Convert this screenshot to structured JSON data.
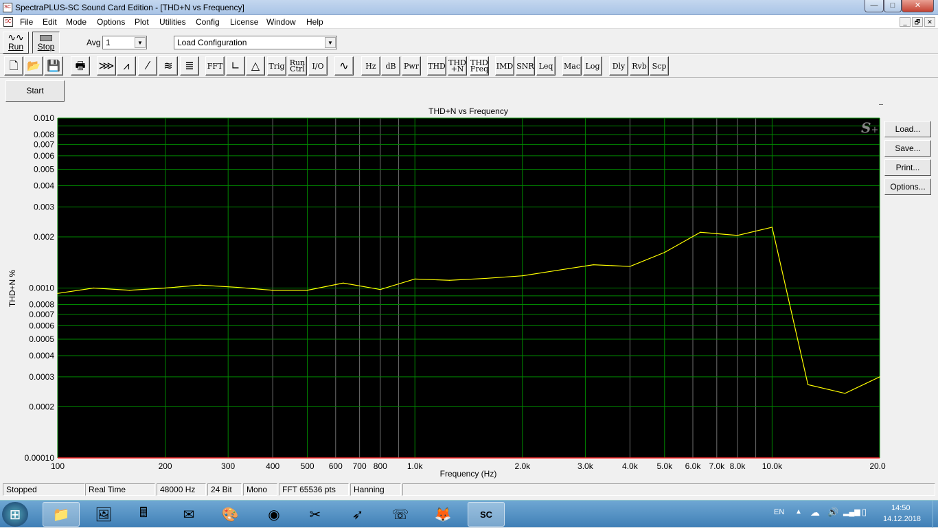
{
  "window": {
    "title": "SpectraPLUS-SC Sound Card Edition - [THD+N vs Frequency]",
    "minimize": "—",
    "maximize": "□",
    "close": "✕"
  },
  "menu": [
    "File",
    "Edit",
    "Mode",
    "Options",
    "Plot",
    "Utilities",
    "Config",
    "License",
    "Window",
    "Help"
  ],
  "mdi_controls": [
    "_",
    "🗗",
    "✕"
  ],
  "toolbar": {
    "run": "Run",
    "stop": "Stop",
    "avg_label": "Avg",
    "avg_value": "1",
    "config_value": "Load Configuration"
  },
  "toolbar2": [
    {
      "id": "new",
      "icon": "new-file-icon",
      "glyph": "🗋"
    },
    {
      "id": "open",
      "icon": "open-folder-icon",
      "glyph": "📂"
    },
    {
      "id": "save",
      "icon": "save-disk-icon",
      "glyph": "💾"
    },
    {
      "id": "print",
      "icon": "printer-icon",
      "glyph": "🖶"
    },
    {
      "id": "time-series",
      "icon": "waveform-icon",
      "glyph": "⋙"
    },
    {
      "id": "spectrum",
      "icon": "spectrum-icon",
      "glyph": "⩘"
    },
    {
      "id": "phase",
      "icon": "phase-icon",
      "glyph": "⁄"
    },
    {
      "id": "spectrogram",
      "icon": "spectrogram-icon",
      "glyph": "≋"
    },
    {
      "id": "3d",
      "icon": "3d-surface-icon",
      "glyph": "≣"
    },
    {
      "label": "FFT"
    },
    {
      "id": "scaling",
      "icon": "axis-scale-icon",
      "glyph": "∟"
    },
    {
      "id": "weighting",
      "icon": "weighting-icon",
      "glyph": "△"
    },
    {
      "label": "Trig"
    },
    {
      "label": "Run Ctrl"
    },
    {
      "label": "I/O"
    },
    {
      "id": "generator",
      "icon": "sine-generator-icon",
      "glyph": "∿"
    },
    {
      "label": "Hz"
    },
    {
      "label": "dB"
    },
    {
      "label": "Pwr"
    },
    {
      "label": "THD"
    },
    {
      "label": "THD +N"
    },
    {
      "label": "THD Freq"
    },
    {
      "label": "IMD"
    },
    {
      "label": "SNR"
    },
    {
      "label": "Leq"
    },
    {
      "label": "Mac"
    },
    {
      "label": "Log"
    },
    {
      "label": "Dly"
    },
    {
      "label": "Rvb"
    },
    {
      "label": "Scp"
    }
  ],
  "start_button": "Start",
  "side_buttons": [
    "Load...",
    "Save...",
    "Print...",
    "Options..."
  ],
  "logo": "S+",
  "chart_data": {
    "type": "line",
    "title": "THD+N vs Frequency",
    "xlabel": "Frequency (Hz)",
    "ylabel": "THD+N  %",
    "xscale": "log",
    "yscale": "log",
    "xlim": [
      100,
      20000
    ],
    "ylim": [
      0.0001,
      0.01
    ],
    "grid": true,
    "xticks": [
      {
        "v": 100,
        "l": "100"
      },
      {
        "v": 200,
        "l": "200"
      },
      {
        "v": 300,
        "l": "300"
      },
      {
        "v": 400,
        "l": "400"
      },
      {
        "v": 500,
        "l": "500"
      },
      {
        "v": 600,
        "l": "600"
      },
      {
        "v": 700,
        "l": "700"
      },
      {
        "v": 800,
        "l": "800"
      },
      {
        "v": 1000,
        "l": "1.0k"
      },
      {
        "v": 2000,
        "l": "2.0k"
      },
      {
        "v": 3000,
        "l": "3.0k"
      },
      {
        "v": 4000,
        "l": "4.0k"
      },
      {
        "v": 5000,
        "l": "5.0k"
      },
      {
        "v": 6000,
        "l": "6.0k"
      },
      {
        "v": 7000,
        "l": "7.0k"
      },
      {
        "v": 8000,
        "l": "8.0k"
      },
      {
        "v": 10000,
        "l": "10.0k"
      },
      {
        "v": 20000,
        "l": "20.0k"
      }
    ],
    "yticks": [
      {
        "v": 0.01,
        "l": "0.010"
      },
      {
        "v": 0.008,
        "l": "0.008"
      },
      {
        "v": 0.007,
        "l": "0.007"
      },
      {
        "v": 0.006,
        "l": "0.006"
      },
      {
        "v": 0.005,
        "l": "0.005"
      },
      {
        "v": 0.004,
        "l": "0.004"
      },
      {
        "v": 0.003,
        "l": "0.003"
      },
      {
        "v": 0.002,
        "l": "0.002"
      },
      {
        "v": 0.001,
        "l": "0.0010"
      },
      {
        "v": 0.0008,
        "l": "0.0008"
      },
      {
        "v": 0.0007,
        "l": "0.0007"
      },
      {
        "v": 0.0006,
        "l": "0.0006"
      },
      {
        "v": 0.0005,
        "l": "0.0005"
      },
      {
        "v": 0.0004,
        "l": "0.0004"
      },
      {
        "v": 0.0003,
        "l": "0.0003"
      },
      {
        "v": 0.0002,
        "l": "0.0002"
      },
      {
        "v": 0.0001,
        "l": "0.00010"
      }
    ],
    "series": [
      {
        "name": "THD+N",
        "color": "#ffff00",
        "x": [
          100,
          126,
          159,
          200,
          250,
          317,
          400,
          500,
          630,
          800,
          1000,
          1250,
          1580,
          2000,
          2500,
          3160,
          4000,
          5000,
          6300,
          8000,
          10000,
          12600,
          16000,
          20000
        ],
        "y": [
          0.00093,
          0.001,
          0.00097,
          0.001,
          0.00104,
          0.00101,
          0.00097,
          0.00097,
          0.00107,
          0.00098,
          0.00113,
          0.00111,
          0.00114,
          0.00118,
          0.00127,
          0.00137,
          0.00134,
          0.00162,
          0.00213,
          0.00204,
          0.00228,
          0.00027,
          0.00024,
          0.0003
        ]
      }
    ]
  },
  "status": [
    "Stopped",
    "Real Time",
    "48000 Hz",
    "24 Bit",
    "Mono",
    "FFT 65536 pts",
    "Hanning"
  ],
  "taskbar": {
    "apps": [
      {
        "icon": "start-orb-icon",
        "g": "⊞"
      },
      {
        "icon": "file-explorer-icon",
        "g": "📁"
      },
      {
        "icon": "image-viewer-icon",
        "g": "🖼"
      },
      {
        "icon": "calculator-icon",
        "g": "🖩"
      },
      {
        "icon": "outlook-icon",
        "g": "✉"
      },
      {
        "icon": "paint-icon",
        "g": "🎨"
      },
      {
        "icon": "chrome-icon",
        "g": "◉"
      },
      {
        "icon": "snipping-tool-icon",
        "g": "✂"
      },
      {
        "icon": "app-bird-icon",
        "g": "➶"
      },
      {
        "icon": "viber-icon",
        "g": "☏"
      },
      {
        "icon": "firefox-icon",
        "g": "🦊"
      },
      {
        "icon": "spectraplus-icon",
        "g": "SC"
      }
    ],
    "lang": "EN",
    "time": "14:50",
    "date": "14.12.2018"
  }
}
